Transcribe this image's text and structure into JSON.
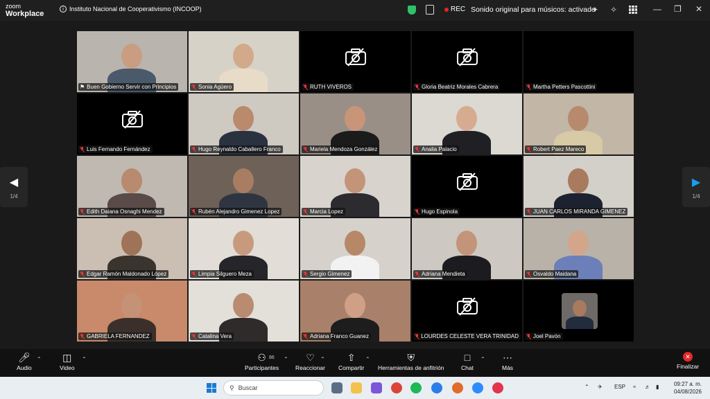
{
  "app": {
    "brand_line1": "zoom",
    "brand_line2": "Workplace"
  },
  "meeting": {
    "title": "Instituto Nacional de Cooperativismo (INCOOP)"
  },
  "titlebar": {
    "rec_label": "REC",
    "sound_status": "Sonido original para músicos: activado"
  },
  "pager": {
    "left_page": "1/4",
    "right_page": "1/4"
  },
  "participants": [
    {
      "name": "Buen Gobierno Servir con Principios",
      "video": true,
      "bg": "#b9b4ad",
      "skin": "#c99d82",
      "shirt": "#4a5a6a",
      "active": true,
      "pinned": true
    },
    {
      "name": "Sonia Agüero",
      "video": true,
      "bg": "#d7d2c7",
      "skin": "#d3a98b",
      "shirt": "#e8dcc8"
    },
    {
      "name": "RUTH VIVEROS",
      "video": false
    },
    {
      "name": "Gloria Beatriz Morales Cabrera",
      "video": false
    },
    {
      "name": "Martha Petters Pascottini",
      "video": false,
      "no_icon": true
    },
    {
      "name": "Luis Fernando Fernández",
      "video": false
    },
    {
      "name": "Hugo Reynaldo Caballero Franco",
      "video": true,
      "bg": "#cfcac1",
      "skin": "#b98a6c",
      "shirt": "#2a3240"
    },
    {
      "name": "Mariela Mendoza González",
      "video": true,
      "bg": "#9a8f86",
      "skin": "#c89578",
      "shirt": "#1b1b1b"
    },
    {
      "name": "Analia Palacio",
      "video": true,
      "bg": "#dcd8d2",
      "skin": "#d6ab90",
      "shirt": "#1f1f24"
    },
    {
      "name": "Robert Paez Mareco",
      "video": true,
      "bg": "#c2b6a6",
      "skin": "#b78a6e",
      "shirt": "#d8c9a7"
    },
    {
      "name": "Edith Daiana Osnaghi Mendez",
      "video": true,
      "bg": "#bfb9b1",
      "skin": "#b88a6e",
      "shirt": "#5a4a48"
    },
    {
      "name": "Rubén Alejandro Gimenez Lopez",
      "video": true,
      "bg": "#6d6158",
      "skin": "#a97d62",
      "shirt": "#2e3540"
    },
    {
      "name": "Marcia Lopez",
      "video": true,
      "bg": "#d8d3cd",
      "skin": "#c49478",
      "shirt": "#2b2b30"
    },
    {
      "name": "Hugo Espinola",
      "video": false
    },
    {
      "name": "JUAN CARLOS MIRANDA GIMENEZ",
      "video": true,
      "bg": "#d3cfc9",
      "skin": "#a87a5e",
      "shirt": "#1d2230"
    },
    {
      "name": "Edgar Ramón Maldonado López",
      "video": true,
      "bg": "#cbbfb4",
      "skin": "#9e7358",
      "shirt": "#3a342e"
    },
    {
      "name": "Limpia Silguero Meza",
      "video": true,
      "bg": "#e2ddd6",
      "skin": "#c79a7e",
      "shirt": "#25252a"
    },
    {
      "name": "Sergio Gimenez",
      "video": true,
      "bg": "#d6d2cb",
      "skin": "#b68868",
      "shirt": "#f2f2f2"
    },
    {
      "name": "Adriana Mendieta",
      "video": true,
      "bg": "#cdc8c1",
      "skin": "#c29479",
      "shirt": "#1c1c20"
    },
    {
      "name": "Osvaldo Maidana",
      "video": true,
      "bg": "#b9b2a8",
      "skin": "#d3a58a",
      "shirt": "#6d7fb8"
    },
    {
      "name": "GABRIELA FERNANDEZ",
      "video": true,
      "bg": "#c88a6a",
      "skin": "#c49377",
      "shirt": "#3a2f2a"
    },
    {
      "name": "Catalina Vera",
      "video": true,
      "bg": "#e3dfd9",
      "skin": "#b98b70",
      "shirt": "#2e2b2a"
    },
    {
      "name": "Adriana Franco Guanez",
      "video": true,
      "bg": "#a9806a",
      "skin": "#cfa086",
      "shirt": "#1d1d1d"
    },
    {
      "name": "LOURDES CELESTE VERA TRINIDAD",
      "video": false
    },
    {
      "name": "Joel Pavón",
      "video": true,
      "bg": "#000000",
      "skin": "#a87a5e",
      "shirt": "#232c3c",
      "thumb": true
    }
  ],
  "toolbar": {
    "audio": "Audio",
    "video": "Video",
    "participants": "Participantes",
    "participants_count": "86",
    "react": "Reaccionar",
    "share": "Compartir",
    "host_tools": "Herramientas de anfitrión",
    "chat": "Chat",
    "more": "Más",
    "end": "Finalizar"
  },
  "taskbar": {
    "search_placeholder": "Buscar",
    "lang": "ESP",
    "time": "09:27 a. m.",
    "date": "04/08/2026"
  },
  "colors": {
    "active_border": "#4fd47a",
    "rec_dot": "#e02828",
    "end_button": "#e02828",
    "shield": "#2ec26a"
  }
}
